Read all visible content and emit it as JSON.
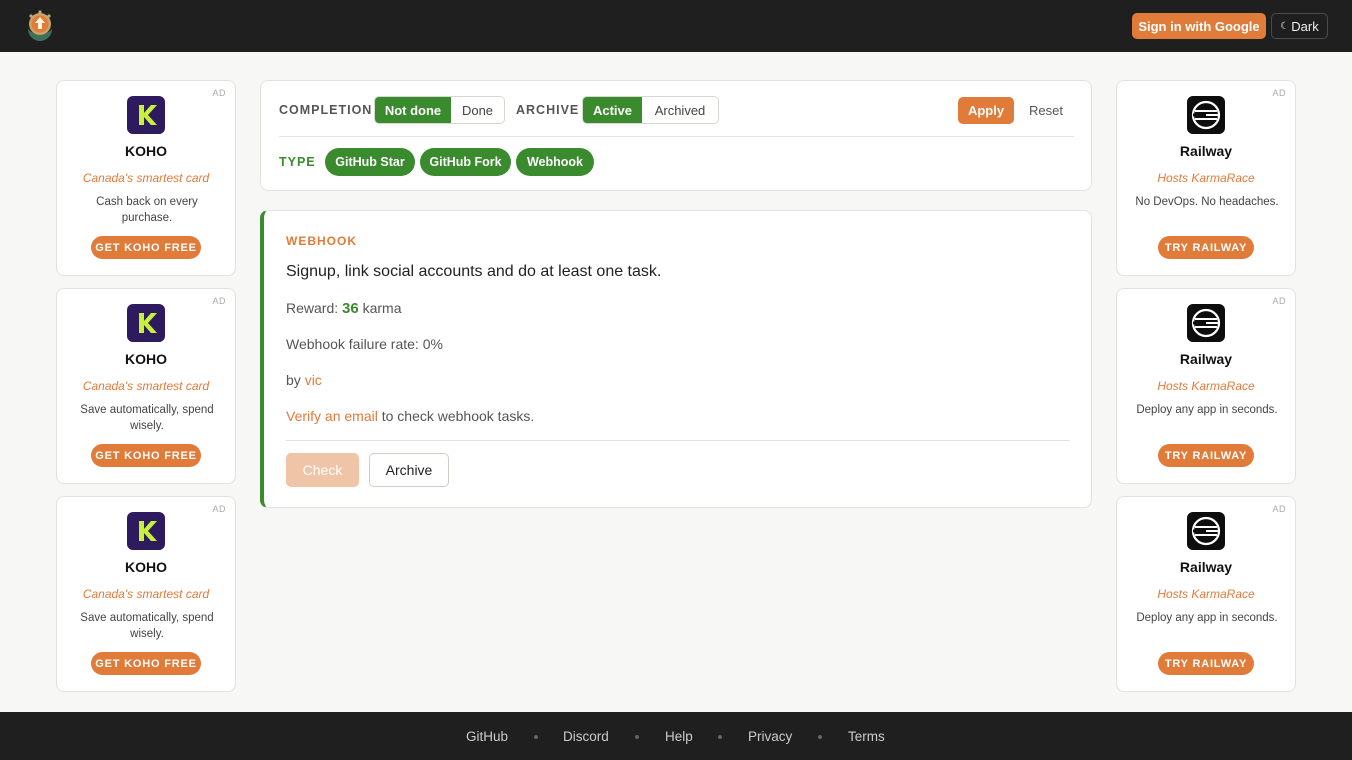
{
  "header": {
    "logo_icon": "karmarace-logo-icon",
    "signin_label": "Sign in with Google",
    "theme_icon": "moon-icon",
    "theme_label": "Dark"
  },
  "ads_left": [
    {
      "tag": "AD",
      "brand": "KOHO",
      "tagline": "Canada's smartest card",
      "desc": "Cash back on every purchase.",
      "cta": "GET KOHO FREE"
    },
    {
      "tag": "AD",
      "brand": "KOHO",
      "tagline": "Canada's smartest card",
      "desc": "Save automatically, spend wisely.",
      "cta": "GET KOHO FREE"
    },
    {
      "tag": "AD",
      "brand": "KOHO",
      "tagline": "Canada's smartest card",
      "desc": "Save automatically, spend wisely.",
      "cta": "GET KOHO FREE"
    }
  ],
  "ads_right": [
    {
      "tag": "AD",
      "brand": "Railway",
      "tagline": "Hosts KarmaRace",
      "desc": "No DevOps. No headaches.",
      "cta": "TRY RAILWAY"
    },
    {
      "tag": "AD",
      "brand": "Railway",
      "tagline": "Hosts KarmaRace",
      "desc": "Deploy any app in seconds.",
      "cta": "TRY RAILWAY"
    },
    {
      "tag": "AD",
      "brand": "Railway",
      "tagline": "Hosts KarmaRace",
      "desc": "Deploy any app in seconds.",
      "cta": "TRY RAILWAY"
    }
  ],
  "filters": {
    "completion_label": "COMPLETION",
    "completion_options": [
      "Not done",
      "Done"
    ],
    "completion_selected": "Not done",
    "archive_label": "ARCHIVE",
    "archive_options": [
      "Active",
      "Archived"
    ],
    "archive_selected": "Active",
    "apply_label": "Apply",
    "reset_label": "Reset",
    "type_label": "TYPE",
    "types": [
      "GitHub Star",
      "GitHub Fork",
      "Webhook"
    ]
  },
  "task": {
    "kind": "WEBHOOK",
    "title": "Signup, link social accounts and do at least one task.",
    "reward_prefix": "Reward:",
    "reward_value": "36",
    "reward_suffix": "karma",
    "failure_rate": "Webhook failure rate: 0%",
    "by_prefix": "by",
    "author": "vic",
    "verify_link": "Verify an email",
    "verify_suffix": "to check webhook tasks.",
    "check_label": "Check",
    "archive_label": "Archive"
  },
  "footer": {
    "links": [
      "GitHub",
      "Discord",
      "Help",
      "Privacy",
      "Terms"
    ]
  },
  "colors": {
    "accent_orange": "#e07b39",
    "accent_green": "#3a8a2e",
    "bar_dark": "#1f1f1f",
    "koho_purple": "#2e1a5e",
    "koho_lime": "#c6f23a"
  }
}
